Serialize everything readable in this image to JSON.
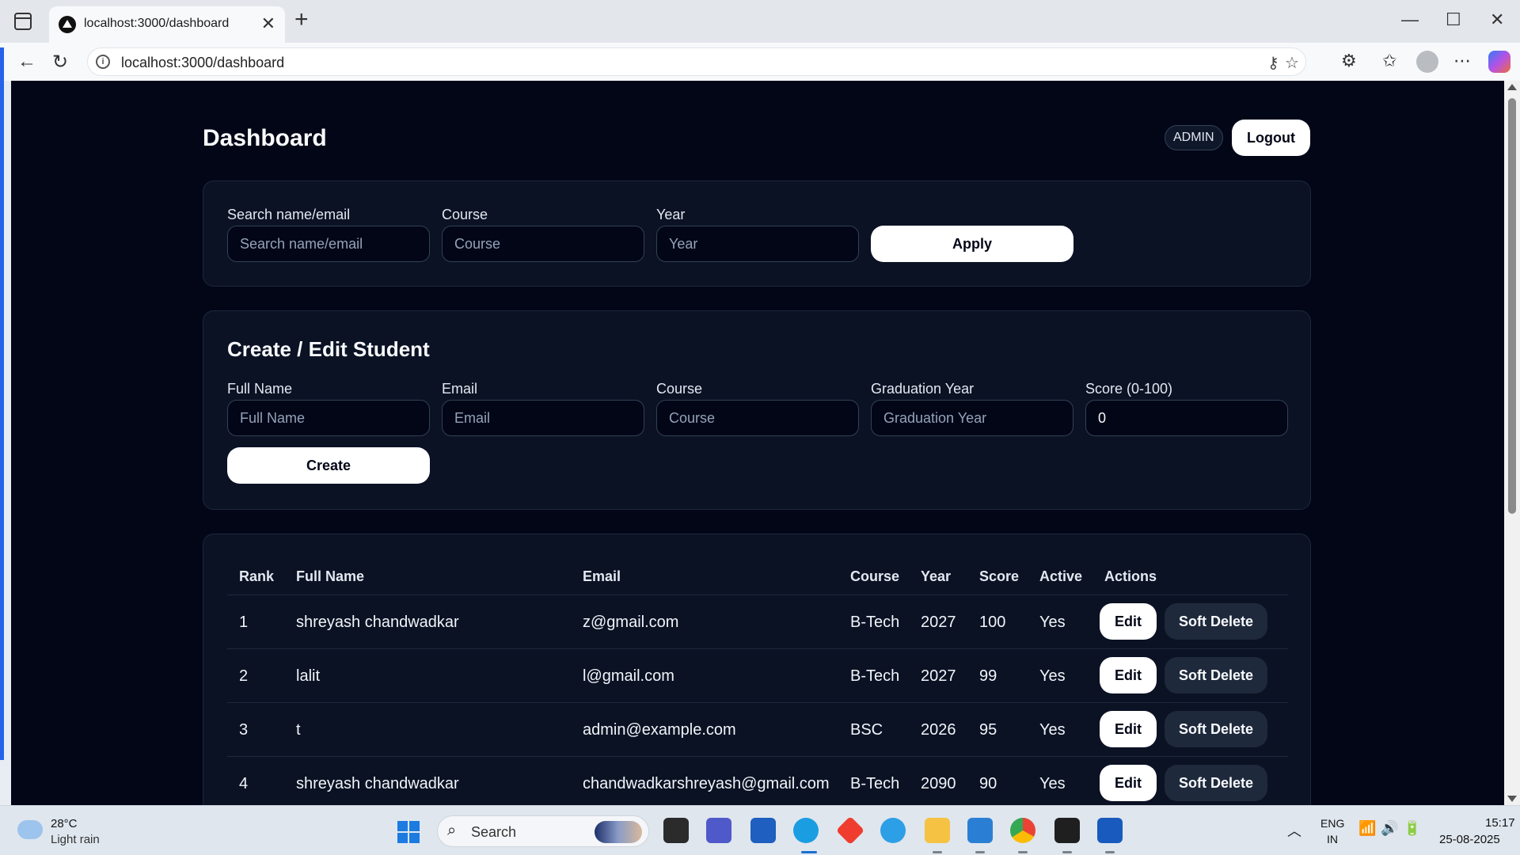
{
  "browser": {
    "tab_title": "localhost:3000/dashboard",
    "url": "localhost:3000/dashboard"
  },
  "header": {
    "title": "Dashboard",
    "role_badge": "ADMIN",
    "logout_label": "Logout"
  },
  "filters": {
    "search_label": "Search name/email",
    "search_placeholder": "Search name/email",
    "course_label": "Course",
    "course_placeholder": "Course",
    "year_label": "Year",
    "year_placeholder": "Year",
    "apply_label": "Apply"
  },
  "student_form": {
    "title": "Create / Edit Student",
    "full_name_label": "Full Name",
    "full_name_placeholder": "Full Name",
    "email_label": "Email",
    "email_placeholder": "Email",
    "course_label": "Course",
    "course_placeholder": "Course",
    "grad_year_label": "Graduation Year",
    "grad_year_placeholder": "Graduation Year",
    "score_label": "Score (0-100)",
    "score_value": "0",
    "create_label": "Create"
  },
  "table": {
    "columns": [
      "Rank",
      "Full Name",
      "Email",
      "Course",
      "Year",
      "Score",
      "Active",
      "Actions"
    ],
    "edit_label": "Edit",
    "delete_label": "Soft Delete",
    "rows": [
      {
        "rank": "1",
        "name": "shreyash chandwadkar",
        "email": "z@gmail.com",
        "course": "B-Tech",
        "year": "2027",
        "score": "100",
        "active": "Yes"
      },
      {
        "rank": "2",
        "name": "lalit",
        "email": "l@gmail.com",
        "course": "B-Tech",
        "year": "2027",
        "score": "99",
        "active": "Yes"
      },
      {
        "rank": "3",
        "name": "t",
        "email": "admin@example.com",
        "course": "BSC",
        "year": "2026",
        "score": "95",
        "active": "Yes"
      },
      {
        "rank": "4",
        "name": "shreyash chandwadkar",
        "email": "chandwadkarshreyash@gmail.com",
        "course": "B-Tech",
        "year": "2090",
        "score": "90",
        "active": "Yes"
      }
    ]
  },
  "taskbar": {
    "weather_temp": "28°C",
    "weather_desc": "Light rain",
    "search_text": "Search",
    "lang_1": "ENG",
    "lang_2": "IN",
    "time": "15:17",
    "date": "25-08-2025"
  },
  "colors": {
    "page_bg": "#020617",
    "card_bg": "#0b1224",
    "border": "#1e293b",
    "primary_button": "#ffffff",
    "secondary_button": "#1e293b"
  }
}
